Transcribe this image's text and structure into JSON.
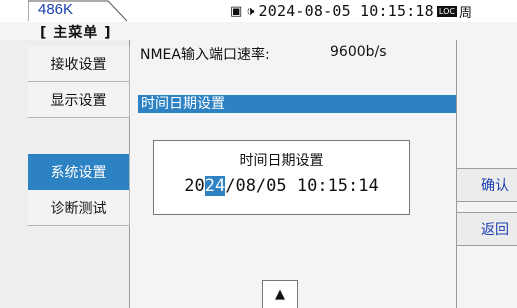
{
  "topbar": {
    "tab_label": "486K",
    "icons": [
      "display-icon",
      "speaker-icon"
    ],
    "display_glyph": "▣",
    "speaker_glyph": "🕩",
    "datetime": "2024-08-05 10:15:18",
    "loc_badge": "LOC",
    "extra": "周"
  },
  "menu_title": "[ 主菜单 ]",
  "left_menu": [
    {
      "label": "接收设置",
      "active": false
    },
    {
      "label": "显示设置",
      "active": false
    },
    {
      "label": "系统设置",
      "active": true
    },
    {
      "label": "诊断测试",
      "active": false
    }
  ],
  "center": {
    "nmea_label": "NMEA输入端口速率:",
    "nmea_value": "9600b/s",
    "selected_row": "时间日期设置"
  },
  "dialog": {
    "title": "时间日期设置",
    "value_prefix": "20",
    "value_highlight": "24",
    "value_suffix": "/08/05 10:15:14"
  },
  "scroll_up_glyph": "▲",
  "right_buttons": [
    {
      "label": "确认"
    },
    {
      "label": "返回"
    }
  ],
  "colors": {
    "accent": "#2d82c4",
    "label_blue": "#1a3fb0"
  }
}
